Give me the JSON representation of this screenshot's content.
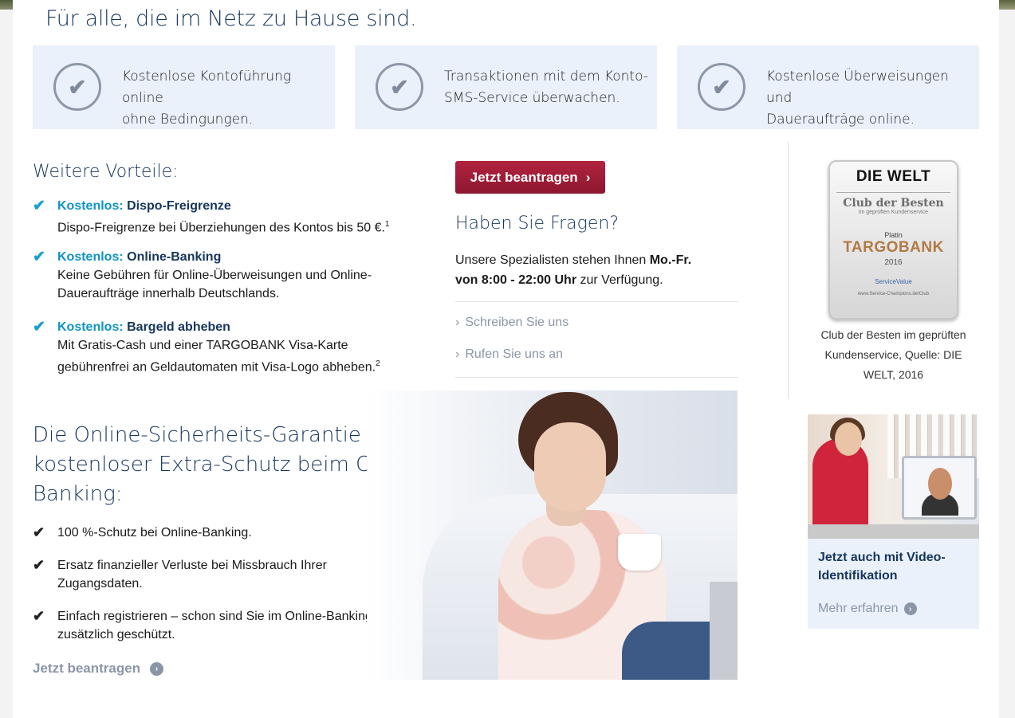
{
  "headline": "Für alle, die im Netz zu Hause sind.",
  "benefits": [
    {
      "icon": "check-circle-icon",
      "line1": "Kostenlose Kontoführung online",
      "line2": "ohne Bedingungen."
    },
    {
      "icon": "check-circle-icon",
      "line1": "Transaktionen mit dem Konto-",
      "line2": "SMS-Service überwachen."
    },
    {
      "icon": "check-circle-icon",
      "line1": "Kostenlose Überweisungen und",
      "line2": "Daueraufträge online."
    }
  ],
  "more_benefits": {
    "title": "Weitere Vorteile:",
    "items": [
      {
        "kw": "Kostenlos:",
        "title": "Dispo-Freigrenze",
        "desc1": "Dispo-Freigrenze bei Überziehungen des Kontos bis 50 €.",
        "sup": "1"
      },
      {
        "kw": "Kostenlos:",
        "title": "Online-Banking",
        "desc1": "Keine Gebühren für Online-Überweisungen und Online-",
        "desc2": "Daueraufträge innerhalb Deutschlands."
      },
      {
        "kw": "Kostenlos:",
        "title": "Bargeld abheben",
        "desc1": "Mit Gratis-Cash und einer TARGOBANK Visa-Karte",
        "desc2": "gebührenfrei an Geldautomaten mit Visa-Logo abheben.",
        "sup": "2"
      }
    ]
  },
  "cta": {
    "label": "Jetzt beantragen",
    "arrow": "›"
  },
  "faq": {
    "title": "Haben Sie Fragen?",
    "text_pre": "Unsere Spezialisten stehen Ihnen ",
    "text_bold1": "Mo.-Fr.",
    "text_bold2": "von 8:00 - 22:00 Uhr",
    "text_post": " zur Verfügung.",
    "links": [
      {
        "arrow": "›",
        "label": "Schreiben Sie uns"
      },
      {
        "arrow": "›",
        "label": "Rufen Sie uns an"
      }
    ]
  },
  "seal": {
    "brand": "DIE WELT",
    "club": "Club der Besten",
    "club_sub": "im geprüften Kundenservice",
    "level": "Platin",
    "bank": "TARGOBANK",
    "year": "2016",
    "org": "ServiceValue",
    "url": "www.Service-Champions.de/Club",
    "caption1": "Club der Besten im geprüften",
    "caption2": "Kundenservice, Quelle: DIE",
    "caption3": "WELT, 2016"
  },
  "video": {
    "title1": "Jetzt auch mit Video-",
    "title2": "Identifikation",
    "link": "Mehr erfahren",
    "arrow": "›"
  },
  "security": {
    "title": "Die Online-Sicherheits-Garantie – Ihr kostenloser Extra-Schutz beim Online-Banking:",
    "items": [
      {
        "line1": "100 %-Schutz bei Online-Banking."
      },
      {
        "line1": "Ersatz finanzieller Verluste bei Missbrauch Ihrer",
        "line2": "Zugangsdaten."
      },
      {
        "line1": "Einfach registrieren – schon sind Sie im Online-Banking",
        "line2": "zusätzlich geschützt."
      }
    ],
    "link": "Jetzt beantragen",
    "arrow": "›"
  },
  "icons": {
    "check": "✔"
  },
  "colors": {
    "navy": "#16365c",
    "cyan": "#0f94c4",
    "cta": "#a31c38",
    "light_blue_bg": "#eaf1fa",
    "muted_link": "#8a96a8"
  }
}
